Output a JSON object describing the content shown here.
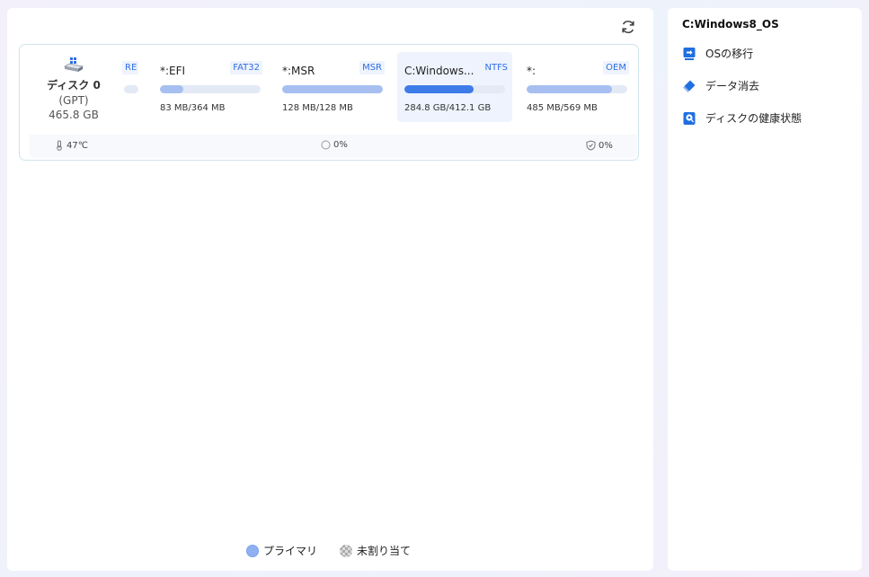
{
  "main": {
    "disk": {
      "name": "ディスク 0",
      "type": "(GPT)",
      "size": "465.8 GB"
    },
    "partitions": [
      {
        "name": "",
        "fs": "RE",
        "usage": "",
        "fill": 0.0
      },
      {
        "name": "*:EFI",
        "fs": "FAT32",
        "usage": "83 MB/364 MB",
        "fill": 0.23
      },
      {
        "name": "*:MSR",
        "fs": "MSR",
        "usage": "128 MB/128 MB",
        "fill": 1.0
      },
      {
        "name": "C:Windows...",
        "fs": "NTFS",
        "usage": "284.8 GB/412.1 GB",
        "fill": 0.69
      },
      {
        "name": "*:",
        "fs": "OEM",
        "usage": "485 MB/569 MB",
        "fill": 0.85
      }
    ],
    "stats": {
      "temperature": "47℃",
      "usage": "0%",
      "health": "0%"
    },
    "legend": {
      "primary": "プライマリ",
      "unallocated": "未割り当て"
    }
  },
  "sidebar": {
    "title": "C:Windows8_OS",
    "actions": [
      {
        "label": "OSの移行",
        "icon": "os-migrate-icon"
      },
      {
        "label": "データ消去",
        "icon": "eraser-icon"
      },
      {
        "label": "ディスクの健康状態",
        "icon": "disk-health-icon"
      }
    ]
  },
  "colors": {
    "accent": "#3d7be8",
    "bar_light": "#a6bff0",
    "fs_tag": "#2f6fe6"
  }
}
